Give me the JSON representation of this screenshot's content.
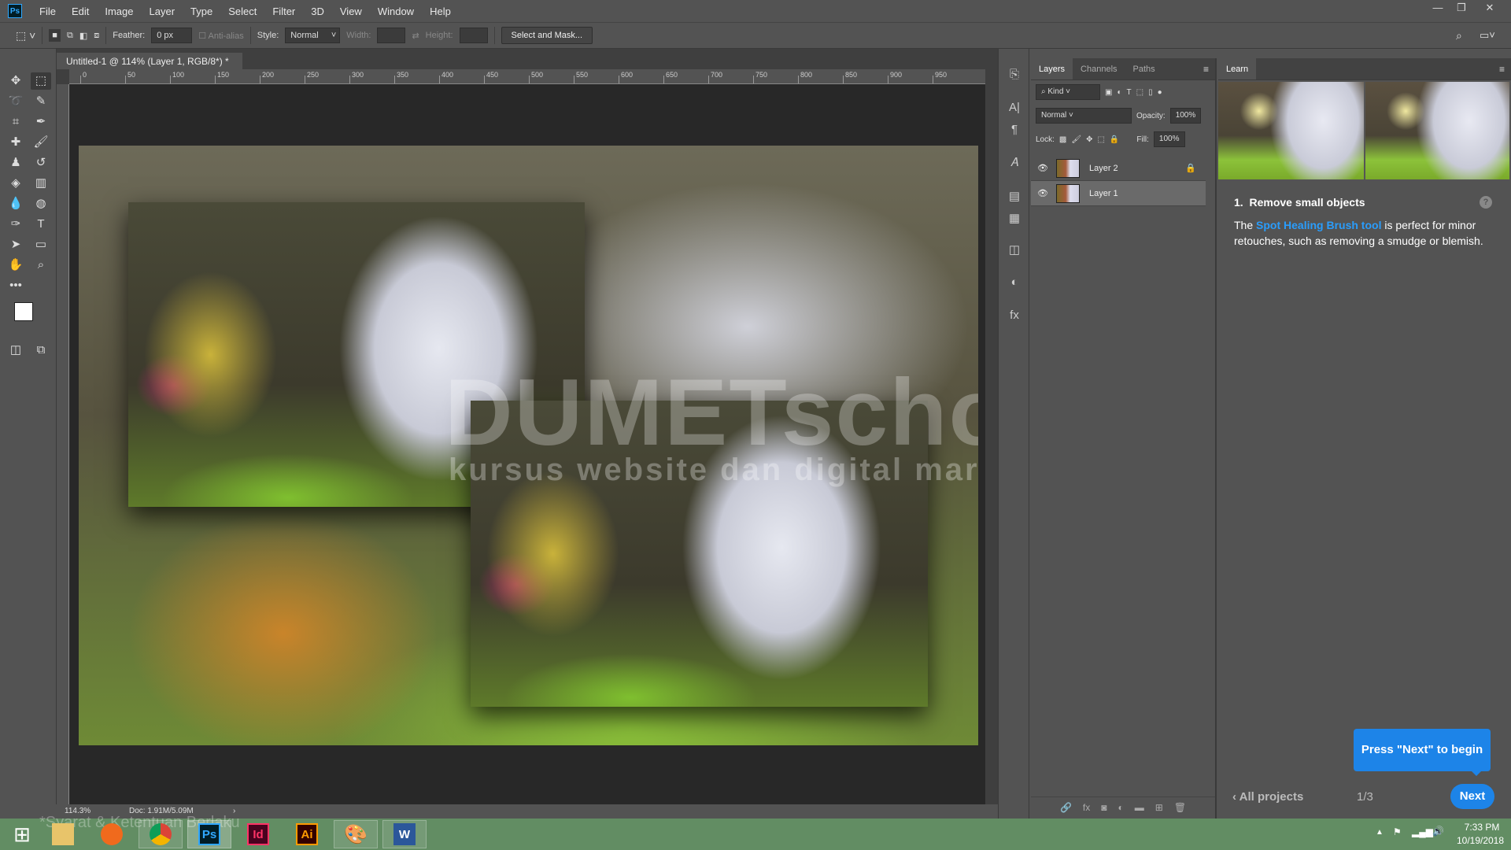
{
  "menubar": {
    "items": [
      "File",
      "Edit",
      "Image",
      "Layer",
      "Type",
      "Select",
      "Filter",
      "3D",
      "View",
      "Window",
      "Help"
    ],
    "logo": "Ps"
  },
  "options": {
    "feather_label": "Feather:",
    "feather_value": "0 px",
    "antialias_label": "Anti-alias",
    "style_label": "Style:",
    "style_value": "Normal",
    "width_label": "Width:",
    "height_label": "Height:",
    "select_mask": "Select and Mask..."
  },
  "document": {
    "tab_title": "Untitled-1 @ 114% (Layer 1, RGB/8*) *",
    "close": "×",
    "watermark_title": "DUMETschool",
    "watermark_sub": "kursus website dan digital marketing"
  },
  "ruler": {
    "top": [
      "0",
      "50",
      "100",
      "150",
      "200",
      "250",
      "300",
      "350",
      "400",
      "450",
      "500",
      "550",
      "600",
      "650",
      "700",
      "750",
      "800",
      "850",
      "900",
      "950"
    ]
  },
  "status": {
    "zoom": "114.3%",
    "doc": "Doc: 1.91M/5.09M",
    "arrow": "›"
  },
  "layers_panel": {
    "tabs": [
      "Layers",
      "Channels",
      "Paths"
    ],
    "kind": "Kind",
    "blend": "Normal",
    "opacity_label": "Opacity:",
    "opacity": "100%",
    "lock_label": "Lock:",
    "fill_label": "Fill:",
    "fill": "100%",
    "layers": [
      {
        "name": "Layer 2",
        "locked": true,
        "visible": true
      },
      {
        "name": "Layer 1",
        "locked": false,
        "visible": true,
        "selected": true
      }
    ]
  },
  "learn": {
    "tab": "Learn",
    "step_num": "1.",
    "step_title": "Remove small objects",
    "desc_pre": "The ",
    "desc_link": "Spot Healing Brush tool",
    "desc_post": " is perfect for minor retouches, such as removing a smudge or blemish.",
    "tooltip": "Press \"Next\" to begin",
    "back": "All projects",
    "page": "1/3",
    "next": "Next",
    "accent": "#1f8cef"
  },
  "taskbar": {
    "time": "7:33 PM",
    "date": "10/19/2018",
    "apps": [
      "Start",
      "File Explorer",
      "Firefox",
      "Chrome",
      "Ps",
      "Id",
      "Ai",
      "Paint",
      "W"
    ],
    "ghost_text": "*Syarat & Ketentuan Berlaku"
  }
}
